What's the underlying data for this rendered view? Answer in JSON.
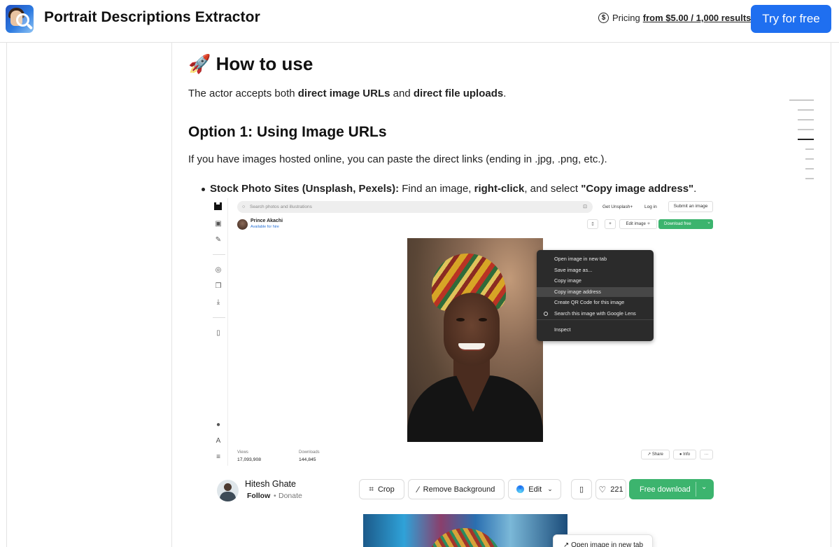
{
  "header": {
    "title": "Portrait Descriptions Extractor",
    "pricing_label": "Pricing",
    "pricing_link": "from $5.00 / 1,000 results",
    "cta": "Try for free"
  },
  "article": {
    "h2_emoji": "🚀",
    "h2": "How to use",
    "p1": {
      "before": "The actor accepts both ",
      "b1": "direct image URLs",
      "mid": " and ",
      "b2": "direct file uploads",
      "after": "."
    },
    "h3": "Option 1: Using Image URLs",
    "p2": "If you have images hosted online, you can paste the direct links (ending in .jpg, .png, etc.).",
    "bullet": {
      "b1": "Stock Photo Sites (Unsplash, Pexels):",
      "t1": " Find an image, ",
      "b2": "right-click",
      "t2": ", and select ",
      "b3": "\"Copy image address\"",
      "t3": "."
    }
  },
  "shot1": {
    "search_placeholder": "Search photos and illustrations",
    "links": [
      "Get Unsplash+",
      "Log in"
    ],
    "submit": "Submit an image",
    "author": "Prince Akachi",
    "hire": "Available for hire",
    "edit_image": "Edit image",
    "download": "Download free",
    "context_menu": [
      "Open image in new tab",
      "Save image as...",
      "Copy image",
      "Copy image address",
      "Create QR Code for this image",
      "Search this image with Google Lens",
      "Inspect"
    ],
    "views_label": "Views",
    "views_value": "17,093,908",
    "downloads_label": "Downloads",
    "downloads_value": "144,845",
    "share": "Share",
    "info": "Info"
  },
  "shot2": {
    "author": "Hitesh Ghate",
    "follow": "Follow",
    "donate": "Donate",
    "crop": "Crop",
    "remove_bg": "Remove Background",
    "edit": "Edit",
    "likes": "221",
    "free_download": "Free download",
    "context_menu_first": "Open image in new tab"
  }
}
